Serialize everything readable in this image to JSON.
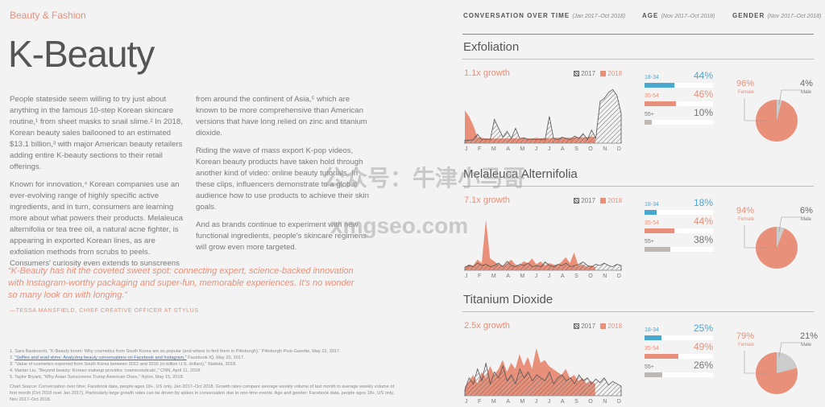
{
  "category": "Beauty & Fashion",
  "title": "K-Beauty",
  "body_col1": [
    "People stateside seem willing to try just about anything in the famous 10-step Korean skincare routine,¹ from sheet masks to snail slime.² In 2018, Korean beauty sales ballooned to an estimated $13.1 billion,³ with major American beauty retailers adding entire K-beauty sections to their retail offerings.",
    "Known for innovation,⁴ Korean companies use an ever-evolving range of highly specific active ingredients, and in turn, consumers are learning more about what powers their products. Melaleuca alternifolia or tea tree oil, a natural acne fighter, is appearing in exported Korean lines, as are exfoliation methods from scrubs to peels. Consumers' curiosity even extends to sunscreens"
  ],
  "body_col2": [
    "from around the continent of Asia,⁵ which are known to be more comprehensive than American versions that have long relied on zinc and titanium dioxide.",
    "Riding the wave of mass export K-pop videos, Korean beauty products have taken hold through another kind of video: online beauty tutorials. In these clips, influencers demonstrate to a global audience how to use products to achieve their skin goals.",
    "And as brands continue to experiment with new functional ingredients, people's skincare regimens will grow even more targeted."
  ],
  "quote": "“K-Beauty has hit the coveted sweet spot: connecting expert, science-backed innovation with Instagram-worthy packaging and super-fun, memorable experiences. It’s no wonder so many look on with longing.”",
  "attribution": "—TESSA MANSFIELD, CHIEF CREATIVE OFFICER AT STYLUS",
  "footnotes": {
    "n1": "1. Sara Bauknecht, “K-Beauty boom: Why cosmetics from South Korea are so popular (and where to find them in Pittsburgh),” Pittsburgh Post-Gazette, May 22, 2017.",
    "n2_prefix": "2. ",
    "n2_link": "“Selfies and snail slime: Analyzing beauty conversations on Facebook and Instagram,”",
    "n2_suffix": " Facebook IQ, May 20, 2017.",
    "n3": "3. “Value of cosmetics exported from South Korea between 2012 and 2016 (in billion U.S. dollars),” Statista, 2018.",
    "n4": "4. Marian Liu, “Beyond beauty: Korean makeup provides ‘cosmeceuticals’,” CNN, April 11, 2018.",
    "n5": "5. Taylor Bryant, “Why Asian Sunscreens Trump American Ones,” Nylon, May 15, 2018.",
    "source": "Chart Source: Conversation over time: Facebook data, people ages 18+, US only, Jan 2017–Oct 2018. Growth rates compare average weekly volume of last month to average weekly volume of first month (Oct 2018 over Jan 2017). Particularly large growth rates can be driven by spikes in conversation due to one-time events. Age and gender: Facebook data, people ages 18+, US only, Nov 2017–Oct 2018."
  },
  "headers": {
    "conv": "CONVERSATION OVER TIME",
    "conv_range": "(Jan 2017–Oct 2018)",
    "age": "AGE",
    "age_range": "(Nov 2017–Oct 2018)",
    "gender": "GENDER",
    "gender_range": "(Nov 2017–Oct 2018)"
  },
  "legend": {
    "y2017": "2017",
    "y2018": "2018"
  },
  "months": [
    "J",
    "F",
    "M",
    "A",
    "M",
    "J",
    "J",
    "A",
    "S",
    "O",
    "N",
    "D"
  ],
  "colors": {
    "accent": "#e8907a",
    "young": "#4aa8d0",
    "old": "#bdb8b4"
  },
  "watermark": [
    "公众号：牛津小马哥",
    "xmgseo.com"
  ],
  "panels": [
    {
      "name": "Exfoliation",
      "growth": "1.1x growth",
      "ages": [
        {
          "label": "18-34",
          "pct": "44%",
          "value": 44
        },
        {
          "label": "35-54",
          "pct": "46%",
          "value": 46
        },
        {
          "label": "55+",
          "pct": "10%",
          "value": 10
        }
      ],
      "gender": {
        "female_pct": "96%",
        "female": "Female",
        "male_pct": "4%",
        "male": "Male",
        "male_value": 4
      },
      "s2017": [
        5,
        5,
        6,
        15,
        6,
        7,
        6,
        40,
        25,
        10,
        20,
        8,
        25,
        8,
        9,
        6,
        7,
        6,
        7,
        6,
        45,
        8,
        6,
        10,
        8,
        6,
        12,
        8,
        16,
        6,
        22,
        8,
        70,
        75,
        85,
        90,
        80,
        50
      ],
      "s2018": [
        55,
        45,
        30,
        10,
        9,
        8,
        8,
        8,
        8,
        8,
        8,
        8,
        8,
        8,
        9,
        8,
        8,
        9,
        8,
        9,
        8,
        9,
        9,
        9,
        9,
        9,
        10,
        10,
        10,
        10,
        11,
        10
      ]
    },
    {
      "name": "Melaleuca Alternifolia",
      "growth": "7.1x growth",
      "ages": [
        {
          "label": "18-34",
          "pct": "18%",
          "value": 18
        },
        {
          "label": "35-54",
          "pct": "44%",
          "value": 44
        },
        {
          "label": "55+",
          "pct": "38%",
          "value": 38
        }
      ],
      "gender": {
        "female_pct": "94%",
        "female": "Female",
        "male_pct": "6%",
        "male": "Male",
        "male_value": 6
      },
      "s2017": [
        5,
        8,
        6,
        12,
        8,
        10,
        6,
        8,
        12,
        6,
        15,
        8,
        6,
        10,
        8,
        12,
        6,
        8,
        6,
        14,
        8,
        6,
        10,
        8,
        12,
        6,
        8,
        10,
        14,
        8,
        6,
        10,
        8,
        12,
        8,
        6,
        10,
        8
      ],
      "s2018": [
        6,
        10,
        8,
        18,
        12,
        85,
        20,
        15,
        10,
        8,
        12,
        18,
        10,
        8,
        15,
        12,
        20,
        10,
        15,
        8,
        12,
        10,
        8,
        14,
        22,
        12,
        30,
        8,
        10,
        6,
        8,
        6
      ]
    },
    {
      "name": "Titanium Dioxide",
      "growth": "2.5x growth",
      "ages": [
        {
          "label": "18-34",
          "pct": "25%",
          "value": 25
        },
        {
          "label": "35-54",
          "pct": "49%",
          "value": 49
        },
        {
          "label": "55+",
          "pct": "26%",
          "value": 26
        }
      ],
      "gender": {
        "female_pct": "79%",
        "female": "Female",
        "male_pct": "21%",
        "male": "Male",
        "male_value": 21
      },
      "s2017": [
        10,
        30,
        20,
        45,
        25,
        55,
        20,
        40,
        30,
        50,
        25,
        35,
        20,
        45,
        30,
        40,
        25,
        35,
        30,
        25,
        40,
        20,
        30,
        35,
        25,
        30,
        20,
        35,
        25,
        30,
        20,
        28,
        22,
        30,
        18,
        24,
        20,
        16
      ],
      "s2018": [
        15,
        25,
        35,
        20,
        40,
        30,
        50,
        35,
        45,
        60,
        40,
        55,
        45,
        70,
        50,
        65,
        45,
        80,
        55,
        60,
        50,
        45,
        40,
        35,
        45,
        30,
        35,
        25,
        30,
        20,
        25,
        20
      ]
    }
  ]
}
